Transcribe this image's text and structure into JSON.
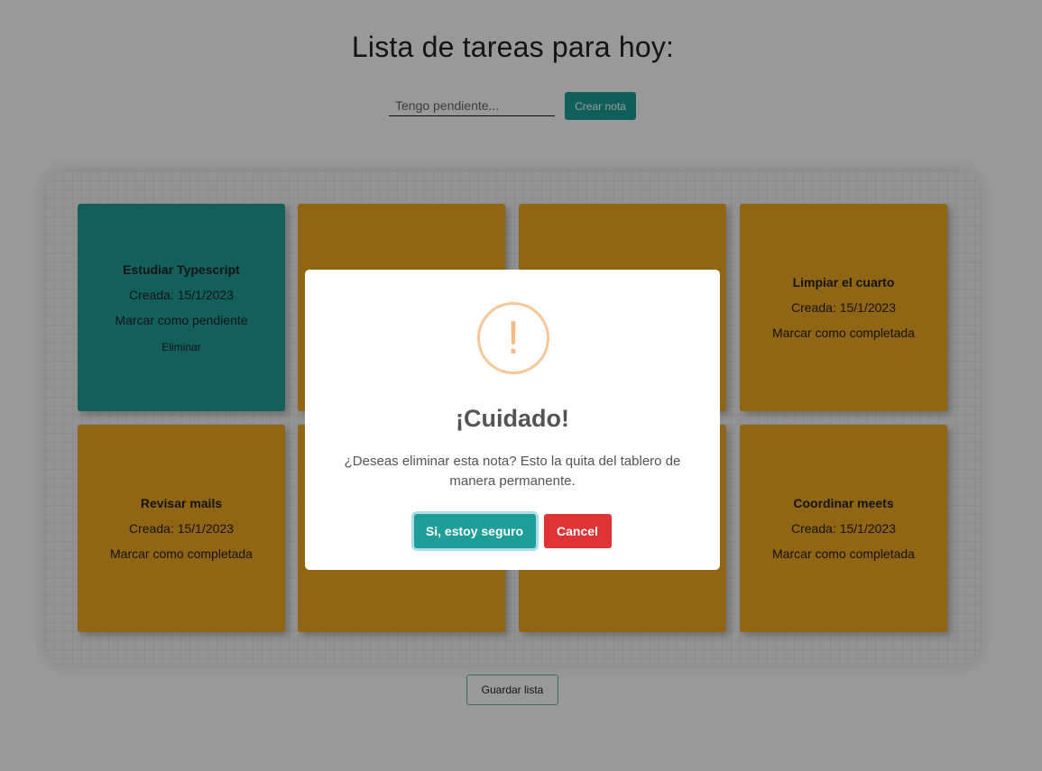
{
  "page": {
    "title": "Lista de tareas para hoy:",
    "input_placeholder": "Tengo pendiente...",
    "create_label": "Crear nota",
    "save_label": "Guardar lista"
  },
  "cards": [
    {
      "title": "Estudiar Typescript",
      "date": "Creada: 15/1/2023",
      "toggle": "Marcar como pendiente",
      "delete": "Eliminar",
      "status": "completed"
    },
    {
      "title": "",
      "date": "",
      "toggle": "",
      "status": "pending"
    },
    {
      "title": "",
      "date": "",
      "toggle": "",
      "status": "pending"
    },
    {
      "title": "Limpiar el cuarto",
      "date": "Creada: 15/1/2023",
      "toggle": "Marcar como completada",
      "status": "pending"
    },
    {
      "title": "Revisar mails",
      "date": "Creada: 15/1/2023",
      "toggle": "Marcar como completada",
      "status": "pending"
    },
    {
      "title": "",
      "date": "",
      "toggle": "",
      "status": "pending"
    },
    {
      "title": "",
      "date": "",
      "toggle": "",
      "status": "pending"
    },
    {
      "title": "Coordinar meets",
      "date": "Creada: 15/1/2023",
      "toggle": "Marcar como completada",
      "status": "pending"
    }
  ],
  "modal": {
    "icon": "exclamation-icon",
    "title": "¡Cuidado!",
    "text": "¿Deseas eliminar esta nota? Esto la quita del tablero de manera permanente.",
    "confirm_label": "Si, estoy seguro",
    "cancel_label": "Cancel",
    "icon_glyph": "!"
  },
  "colors": {
    "accent": "#1d9e98",
    "note": "#f0a820",
    "danger": "#e03434",
    "warning": "#f8bb86"
  }
}
